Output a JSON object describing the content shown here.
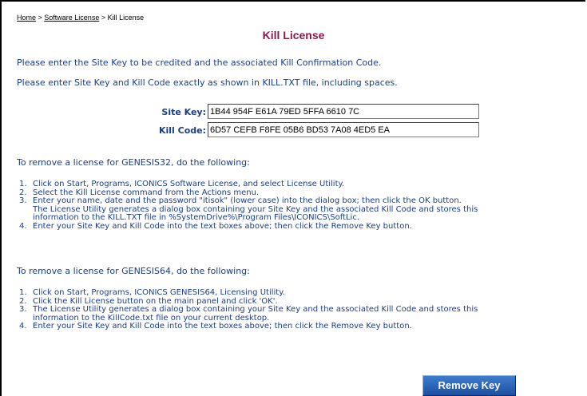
{
  "breadcrumb": {
    "home": "Home",
    "sep1": " > ",
    "software_license": "Software License",
    "sep2": " > ",
    "current": "Kill License"
  },
  "title": "Kill License",
  "intro": [
    "Please enter the Site Key to be credited and the associated Kill Confirmation Code.",
    "Please enter Site Key and Kill Code exactly as shown in KILL.TXT file, including spaces."
  ],
  "form": {
    "site_key_label": "Site Key:",
    "site_key_value": "1B44 954F E61A 79ED 5FFA 6610 7C",
    "kill_code_label": "Kill Code:",
    "kill_code_value": "6D57 CEFB F8FE 05B6 BD53 7A08 4ED5 EA"
  },
  "genesis32": {
    "heading": "To remove a license for GENESIS32, do the following:",
    "steps": [
      {
        "num": "1.",
        "text": "Click on Start, Programs, ICONICS Software License, and select License Utility."
      },
      {
        "num": "2.",
        "text": "Select the Kill License command from the Actions menu."
      },
      {
        "num": "3.",
        "text": "Enter your name, date and the password \"itisok\" (lower case) into the dialog box; then click the OK button."
      },
      {
        "num": "",
        "text": "The License Utility generates a dialog box containing your Site Key and the associated Kill Code and stores this"
      },
      {
        "num": "",
        "text": "information to the KILL.TXT file in %SystemDrive%\\Program Files\\ICONICS\\SoftLic."
      },
      {
        "num": "4.",
        "text": "Enter your Site Key and Kill Code into the text boxes above; then click the Remove Key button."
      }
    ]
  },
  "genesis64": {
    "heading": "To remove a license for GENESIS64, do the following:",
    "steps": [
      {
        "num": "1.",
        "text": "Click on Start, Programs, ICONICS GENESIS64, Licensing Utility."
      },
      {
        "num": "2.",
        "text": "Click the Kill License button on the main panel and click 'OK'."
      },
      {
        "num": "3.",
        "text": "The License Utility generates a dialog box containing your Site Key and the associated Kill Code and stores this"
      },
      {
        "num": "",
        "text": "information to the KillCode.txt file on your current desktop."
      },
      {
        "num": "4.",
        "text": "Enter your Site Key and Kill Code into the text boxes above; then click the Remove Key button."
      }
    ]
  },
  "remove_button_label": "Remove Key"
}
